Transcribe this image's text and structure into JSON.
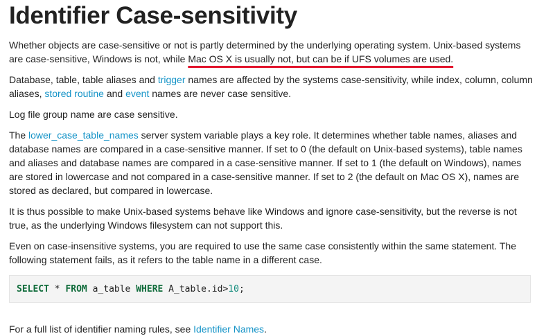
{
  "title": "Identifier Case-sensitivity",
  "p1": {
    "text_a": "Whether objects are case-sensitive or not is partly determined by the underlying operating system. Unix-based systems are case-sensitive, Windows is not, while ",
    "underlined": "Mac OS X is usually not, but can be if UFS volumes are used.",
    "underline_color": "#e2142c"
  },
  "p2": {
    "text_a": "Database, table, table aliases and ",
    "link_trigger": "trigger",
    "text_b": " names are affected by the systems case-sensitivity, while index, column, column aliases, ",
    "link_stored_routine": "stored routine",
    "text_c": " and ",
    "link_event": "event",
    "text_d": " names are never case sensitive."
  },
  "p3": {
    "text": "Log file group name are case sensitive."
  },
  "p4": {
    "text_a": "The ",
    "link_lower_case": "lower_case_table_names",
    "text_b": " server system variable plays a key role. It determines whether table names, aliases and database names are compared in a case-sensitive manner. If set to 0 (the default on Unix-based systems), table names and aliases and database names are compared in a case-sensitive manner. If set to 1 (the default on Windows), names are stored in lowercase and not compared in a case-sensitive manner. If set to 2 (the default on Mac OS X), names are stored as declared, but compared in lowercase."
  },
  "p5": {
    "text": "It is thus possible to make Unix-based systems behave like Windows and ignore case-sensitivity, but the reverse is not true, as the underlying Windows filesystem can not support this."
  },
  "p6": {
    "text": "Even on case-insensitive systems, you are required to use the same case consistently within the same statement. The following statement fails, as it refers to the table name in a different case."
  },
  "code": {
    "kw_select": "SELECT",
    "star": " * ",
    "kw_from": "FROM",
    "table": " a_table ",
    "kw_where": "WHERE",
    "cond": " A_table.id>",
    "num": "10",
    "end": ";"
  },
  "p7": {
    "text_a": "For a full list of identifier naming rules, see ",
    "link_identifier_names": "Identifier Names",
    "text_b": "."
  },
  "colors": {
    "link": "#1493c7",
    "text": "#222222",
    "code_keyword": "#0f6b3a",
    "code_number": "#0f8a7a",
    "code_background": "#f4f4f4"
  }
}
